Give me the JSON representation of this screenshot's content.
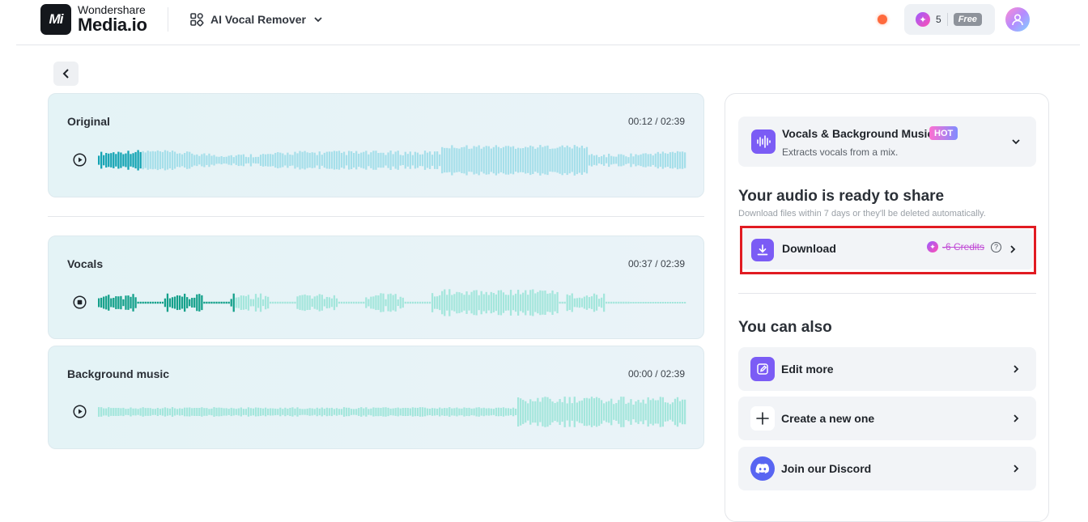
{
  "header": {
    "brand_line1": "Wondershare",
    "brand_line2": "Media.io",
    "logo_mark": "Mi",
    "tool_name": "AI Vocal Remover",
    "credits": "5",
    "plan_badge": "Free"
  },
  "tracks": [
    {
      "title": "Original",
      "time": "00:12 / 02:39",
      "progress": 0.075,
      "state": "play"
    },
    {
      "title": "Vocals",
      "time": "00:37 / 02:39",
      "progress": 0.233,
      "state": "stop"
    },
    {
      "title": "Background music",
      "time": "00:00 / 02:39",
      "progress": 0.0,
      "state": "play"
    }
  ],
  "colors": {
    "wave_played_original": "#12a3b3",
    "wave_unplayed_original": "#a6dfea",
    "wave_played_vocals": "#13a08a",
    "wave_unplayed_vocals": "#a4e6dc",
    "wave_unplayed_music": "#a4e6dc",
    "accent": "#7b5cf5",
    "highlight": "#e11b22"
  },
  "panel": {
    "mode": {
      "title": "Vocals & Background Music",
      "badge": "HOT",
      "subtitle": "Extracts vocals from a mix.",
      "icon": "waveform-icon"
    },
    "ready_title": "Your audio is ready to share",
    "ready_subtitle": "Download files within 7 days or they'll be deleted automatically.",
    "download": {
      "label": "Download",
      "credits": "-6 Credits",
      "help": "?"
    },
    "also_title": "You can also",
    "options": [
      {
        "label": "Edit more",
        "icon": "edit-icon"
      },
      {
        "label": "Create a new one",
        "icon": "plus-icon"
      },
      {
        "label": "Join our Discord",
        "icon": "discord-icon"
      }
    ]
  }
}
